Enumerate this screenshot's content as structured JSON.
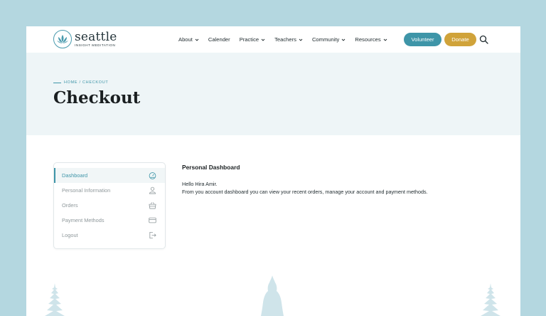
{
  "logo": {
    "word": "seattle",
    "sub": "INSIGHT MEDITATION",
    "icon": "lotus-icon"
  },
  "nav": [
    {
      "label": "About",
      "dropdown": true
    },
    {
      "label": "Calender",
      "dropdown": false
    },
    {
      "label": "Practice",
      "dropdown": true
    },
    {
      "label": "Teachers",
      "dropdown": true
    },
    {
      "label": "Community",
      "dropdown": true
    },
    {
      "label": "Resources",
      "dropdown": true
    }
  ],
  "buttons": {
    "volunteer": "Volunteer",
    "donate": "Donate"
  },
  "hero": {
    "breadcrumb": "HOME / CHECKOUT",
    "title": "Checkout"
  },
  "sidebar": {
    "items": [
      {
        "label": "Dashboard",
        "icon": "gauge-icon",
        "active": true
      },
      {
        "label": "Personal Information",
        "icon": "user-icon",
        "active": false
      },
      {
        "label": "Orders",
        "icon": "basket-icon",
        "active": false
      },
      {
        "label": "Payment Methods",
        "icon": "credit-card-icon",
        "active": false
      },
      {
        "label": "Logout",
        "icon": "logout-icon",
        "active": false
      }
    ]
  },
  "content": {
    "title": "Personal Dashboard",
    "greeting": "Hello Hira Amir.",
    "description": "From you account dashboard you can view your recent orders, manage your account and payment methods."
  },
  "colors": {
    "accent": "#3e95a8",
    "donate": "#d0a33a",
    "background": "#b4d7e0",
    "hero": "#eef5f7"
  }
}
